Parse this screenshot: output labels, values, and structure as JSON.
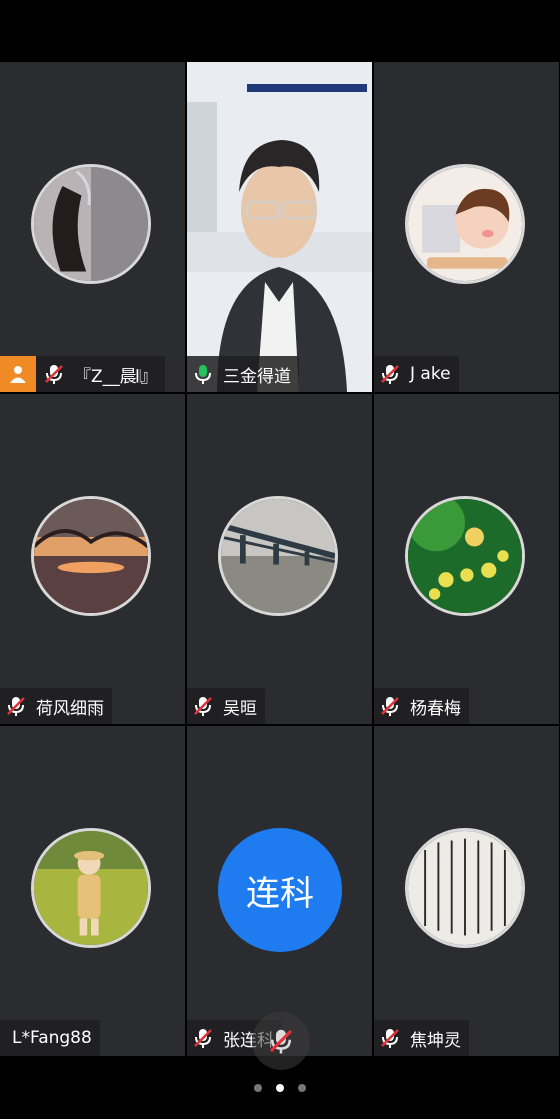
{
  "participants": [
    {
      "name": "『Z__晨𝄃』",
      "mic": "muted",
      "host": true,
      "avatar": "girl-hair-photo"
    },
    {
      "name": "三金得道",
      "mic": "active",
      "host": false,
      "avatar": "live-video"
    },
    {
      "name": "J ake",
      "mic": "muted",
      "host": false,
      "avatar": "cartoon-boy"
    },
    {
      "name": "荷风细雨",
      "mic": "muted",
      "host": false,
      "avatar": "sunset-lake"
    },
    {
      "name": "吴晅",
      "mic": "muted",
      "host": false,
      "avatar": "bridge-river"
    },
    {
      "name": "杨春梅",
      "mic": "muted",
      "host": false,
      "avatar": "green-flowers"
    },
    {
      "name": "L*Fang88",
      "mic": "none",
      "host": false,
      "avatar": "child-field"
    },
    {
      "name": "张连科",
      "mic": "muted",
      "host": false,
      "avatar_text": "连科"
    },
    {
      "name": "焦坤灵",
      "mic": "muted",
      "host": false,
      "avatar": "calligraphy"
    }
  ],
  "pagination": {
    "pages": 3,
    "current": 2
  },
  "colors": {
    "tile": "#2b2c30",
    "active_border": "#1fb04f",
    "mic_active": "#21c35a",
    "mic_muted": "#e0323a",
    "host_badge": "#f08a24",
    "text_avatar": "#1e7cf0"
  }
}
